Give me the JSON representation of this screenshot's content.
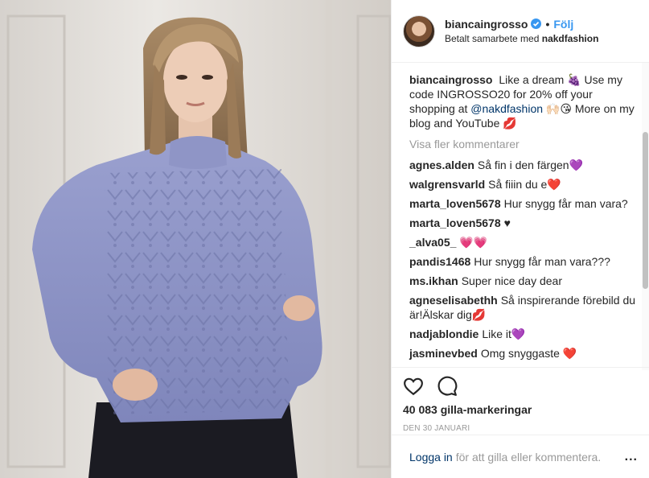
{
  "header": {
    "username": "biancaingrosso",
    "separator": "•",
    "follow_label": "Följ",
    "sponsor_prefix": "Betalt samarbete med",
    "sponsor_name": "nakdfashion"
  },
  "caption": {
    "username": "biancaingrosso",
    "text_part1": "Like a dream 🍇 Use my code INGROSSO20 for 20% off your shopping at",
    "mention": "@nakdfashion",
    "text_part2": "🙌🏻😘 More on my blog and YouTube 💋"
  },
  "load_more_label": "Visa fler kommentarer",
  "comments": [
    {
      "user": "agnes.alden",
      "text": "Så fin i den färgen💜"
    },
    {
      "user": "walgrensvarld",
      "text": "Så fiiin du e❤️"
    },
    {
      "user": "marta_loven5678",
      "text": "Hur snygg får man vara?"
    },
    {
      "user": "marta_loven5678",
      "text": "♥"
    },
    {
      "user": "_alva05_",
      "text": "💗💗"
    },
    {
      "user": "pandis1468",
      "text": "Hur snygg får man vara???"
    },
    {
      "user": "ms.ikhan",
      "text": "Super nice day dear"
    },
    {
      "user": "agneselisabethh",
      "text": "Så inspirerande förebild du är!Älskar dig💋"
    },
    {
      "user": "nadjablondie",
      "text": "Like it💜"
    },
    {
      "user": "jasminevbed",
      "text": "Omg snyggaste ❤️"
    }
  ],
  "actions": {
    "like_icon": "heart-icon",
    "comment_icon": "comment-bubble-icon",
    "likes_text": "40 083 gilla-markeringar",
    "date_text": "DEN 30 JANUARI"
  },
  "login": {
    "link_label": "Logga in",
    "rest_text": "för att gilla eller kommentera.",
    "options_label": "..."
  },
  "colors": {
    "accent": "#3897f0",
    "link": "#003569",
    "muted": "#999999",
    "sweater": "#8c93c6"
  }
}
